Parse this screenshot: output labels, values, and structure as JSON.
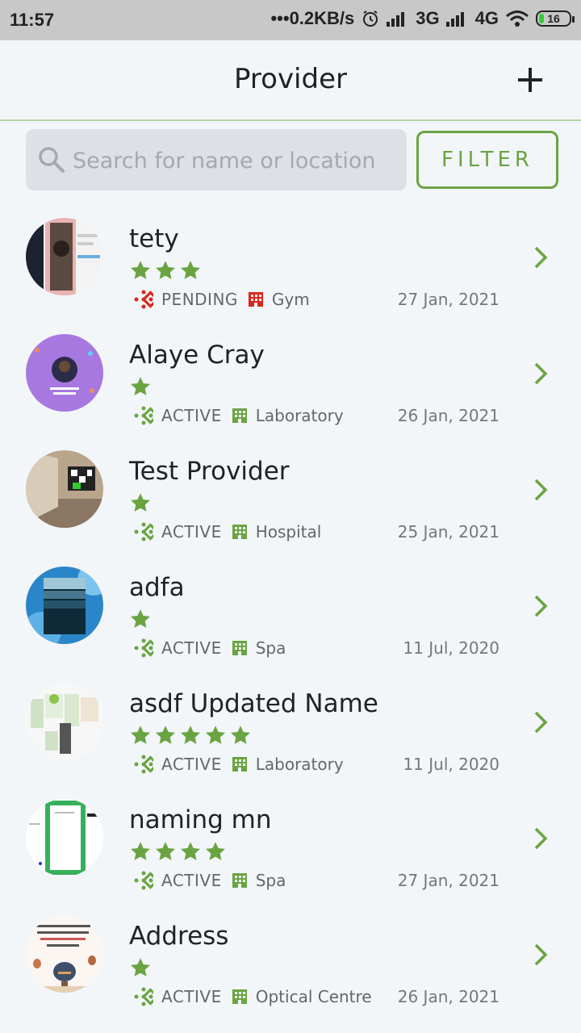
{
  "status_bar": {
    "time": "11:57",
    "network_speed": "•••0.2KB/s",
    "net_3g": "3G",
    "net_4g": "4G",
    "battery": "16",
    "icons": [
      "alarm-icon",
      "signal-icon",
      "wifi-icon",
      "battery-icon"
    ]
  },
  "header": {
    "title": "Provider",
    "add_icon": "plus-icon"
  },
  "search": {
    "placeholder": "Search for name or location",
    "value": ""
  },
  "filter_label": "FILTER",
  "colors": {
    "accent": "#6aa442",
    "pending": "#d9261c",
    "text": "#222222",
    "muted": "#666666",
    "background": "#f2f6f9"
  },
  "providers": [
    {
      "name": "tety",
      "stars": 3,
      "status": "PENDING",
      "type": "Gym",
      "date": "27 Jan, 2021"
    },
    {
      "name": "Alaye Cray",
      "stars": 1,
      "status": "ACTIVE",
      "type": "Laboratory",
      "date": "26 Jan, 2021"
    },
    {
      "name": "Test Provider",
      "stars": 1,
      "status": "ACTIVE",
      "type": "Hospital",
      "date": "25 Jan, 2021"
    },
    {
      "name": "adfa",
      "stars": 1,
      "status": "ACTIVE",
      "type": "Spa",
      "date": "11 Jul, 2020"
    },
    {
      "name": "asdf Updated Name",
      "stars": 5,
      "status": "ACTIVE",
      "type": "Laboratory",
      "date": "11 Jul, 2020"
    },
    {
      "name": "naming mn",
      "stars": 4,
      "status": "ACTIVE",
      "type": "Spa",
      "date": "27 Jan, 2021"
    },
    {
      "name": "Address",
      "stars": 1,
      "status": "ACTIVE",
      "type": "Optical Centre",
      "date": "26 Jan, 2021"
    }
  ]
}
